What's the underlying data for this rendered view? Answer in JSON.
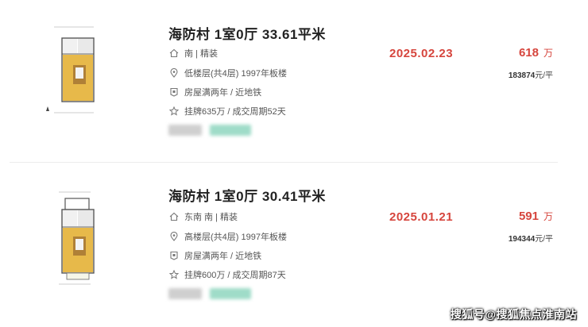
{
  "listings": [
    {
      "title": "海防村 1室0厅 33.61平米",
      "orientation": "南 | 精装",
      "floor_info": "低楼层(共4层) 1997年板楼",
      "features": "房屋满两年 / 近地铁",
      "listing_info": "挂牌635万 / 成交周期52天",
      "deal_date": "2025.02.23",
      "total_price": "618",
      "price_unit": "万",
      "unit_price_num": "183874",
      "unit_price_suffix": "元/平"
    },
    {
      "title": "海防村 1室0厅 30.41平米",
      "orientation": "东南 南 | 精装",
      "floor_info": "高楼层(共4层) 1997年板楼",
      "features": "房屋满两年 / 近地铁",
      "listing_info": "挂牌600万 / 成交周期87天",
      "deal_date": "2025.01.21",
      "total_price": "591",
      "price_unit": "万",
      "unit_price_num": "194344",
      "unit_price_suffix": "元/平"
    }
  ],
  "icons": {
    "orientation": "house-icon",
    "floor": "location-pin-icon",
    "features": "tag-icon",
    "listing": "star-icon"
  },
  "colors": {
    "accent": "#d6453d",
    "floor_wood": "#e7b94a"
  },
  "watermark": "搜狐号@搜狐焦点淮南站"
}
